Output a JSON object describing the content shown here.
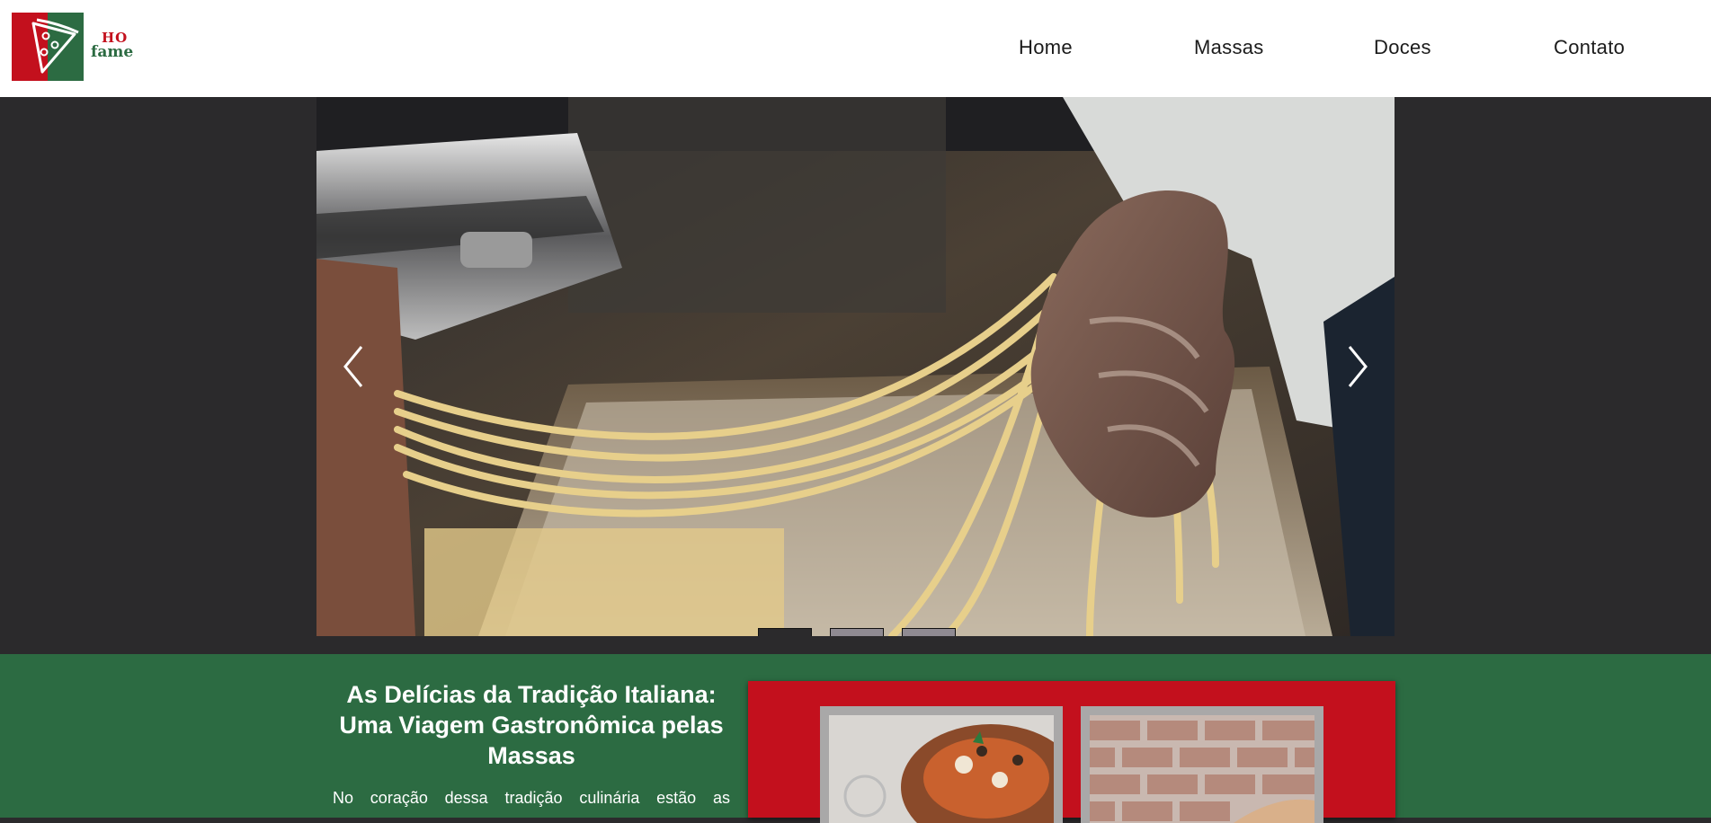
{
  "logo": {
    "line1": "HO",
    "line2": "fame",
    "icon": "pizza-slice-icon",
    "colors": {
      "red": "#c3101d",
      "green": "#2c6b42"
    }
  },
  "nav": {
    "items": [
      {
        "label": "Home"
      },
      {
        "label": "Massas"
      },
      {
        "label": "Doces"
      },
      {
        "label": "Contato"
      }
    ]
  },
  "carousel": {
    "slide_image": "fresh-pasta-hands-photo",
    "prev_icon": "chevron-left-icon",
    "next_icon": "chevron-right-icon",
    "slide_count": 3,
    "active_index": 0
  },
  "intro": {
    "title": "As Delícias da Tradição Italiana: Uma Viagem Gastronômica pelas Massas",
    "text": "No coração dessa tradição culinária estão as"
  },
  "gallery": {
    "items": [
      {
        "image": "pizza-calzone-photo"
      },
      {
        "image": "brick-wall-photo"
      }
    ]
  },
  "colors": {
    "brand_red": "#c3101d",
    "brand_green": "#2c6b42",
    "dark_band": "#2b2a2c"
  }
}
